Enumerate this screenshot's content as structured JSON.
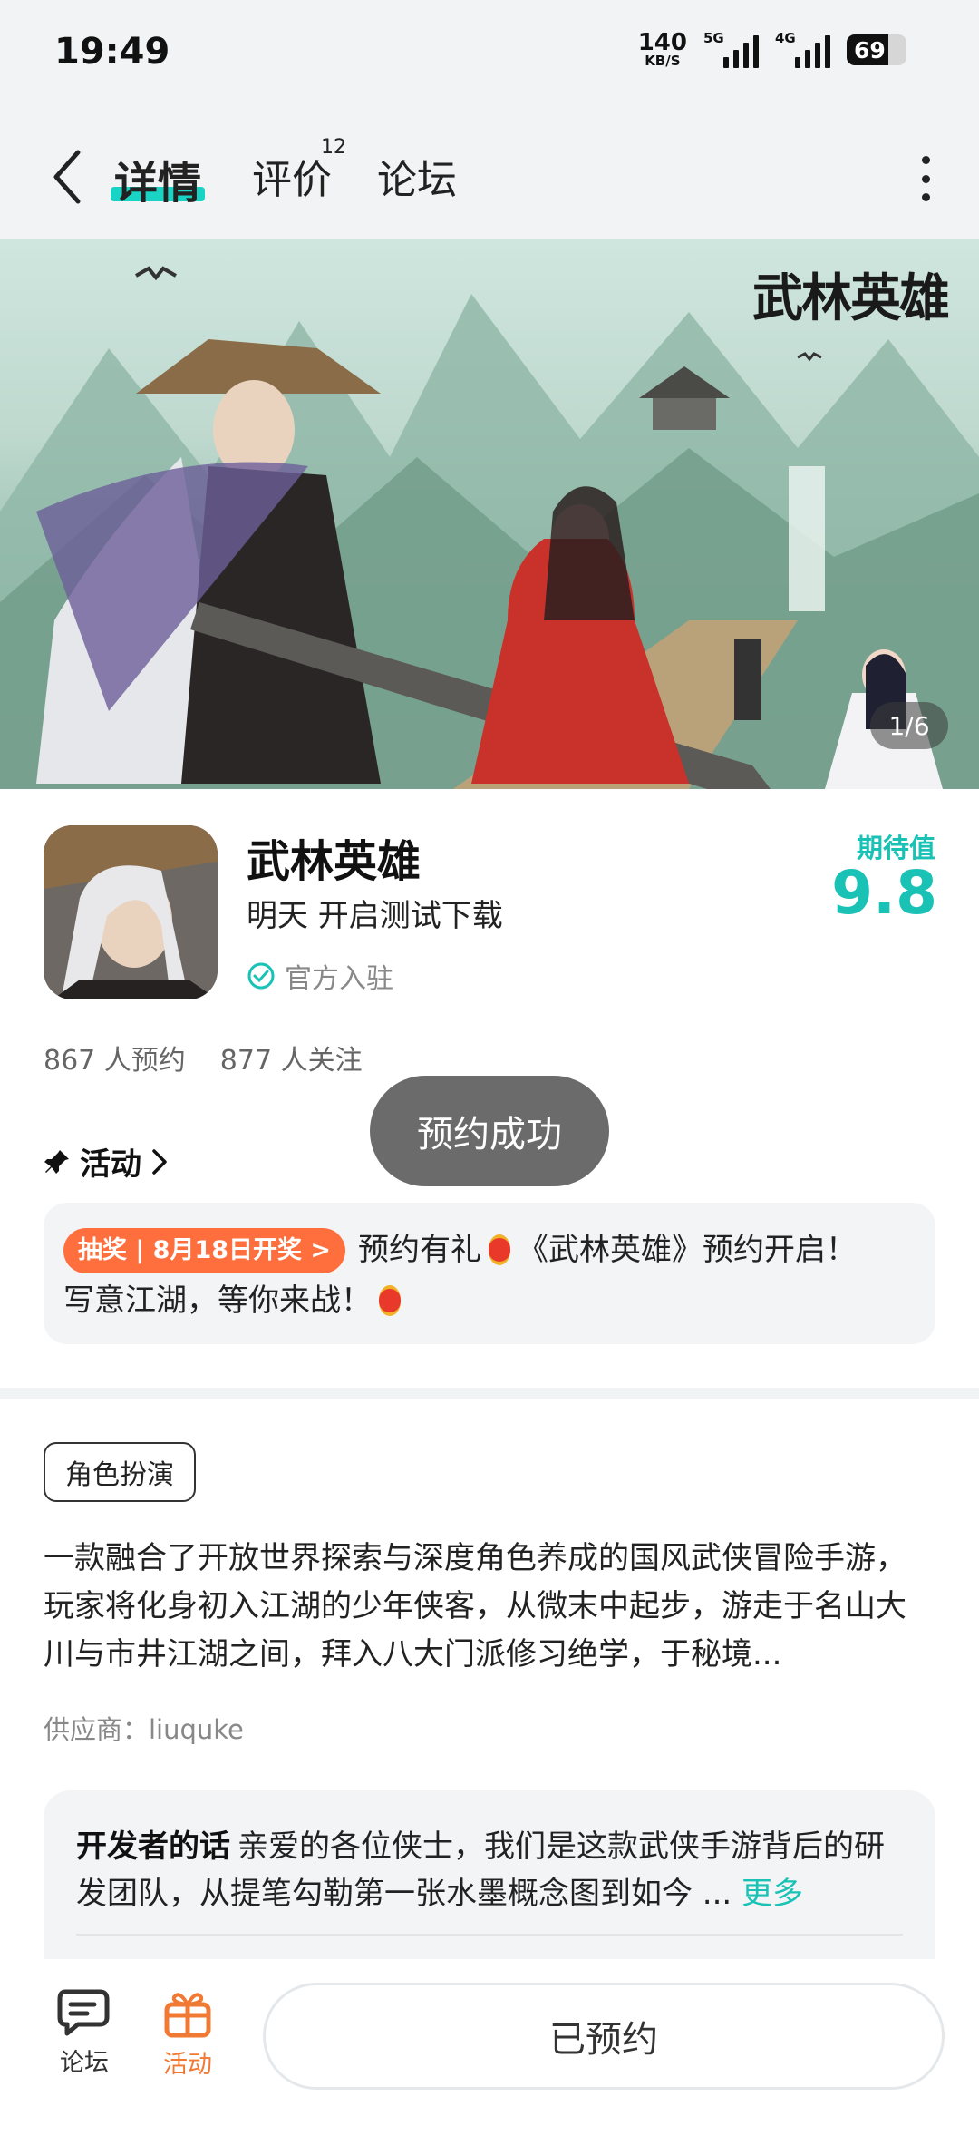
{
  "status_bar": {
    "time": "19:49",
    "net_speed": "140",
    "net_unit": "KB/S",
    "signal_1": "5G",
    "signal_2": "4G",
    "battery": "69"
  },
  "header": {
    "tabs": [
      {
        "label": "详情",
        "active": true
      },
      {
        "label": "评价",
        "badge": "12"
      },
      {
        "label": "论坛"
      }
    ],
    "back_icon": "chevron-left-icon",
    "more_icon": "more-vertical-icon"
  },
  "banner": {
    "logo_text": "武林英雄",
    "counter": "1/6"
  },
  "app": {
    "name": "武林英雄",
    "subtitle": "明天 开启测试下载",
    "official": "官方入驻",
    "score_label": "期待值",
    "score": "9.8",
    "stats": [
      "867 人预约",
      "877 人关注"
    ]
  },
  "toast": "预约成功",
  "activity": {
    "title": "活动",
    "tag": "抽奖 | 8月18日开奖 >",
    "text_1": "预约有礼",
    "text_2": "《武林英雄》预约开启！",
    "text_3": "写意江湖，等你来战！"
  },
  "details": {
    "genre": "角色扮演",
    "description": "一款融合了开放世界探索与深度角色养成的国风武侠冒险手游，玩家将化身初入江湖的少年侠客，从微末中起步，游走于名山大川与市井江湖之间，拜入八大门派修习绝学，于秘境...",
    "supplier": "供应商：liuquke"
  },
  "developer": {
    "title": "开发者的话",
    "text": "亲爱的各位侠士，我们是这款武侠手游背后的研发团队，从提笔勾勒第一张水墨概念图到如今 ...",
    "more": "更多"
  },
  "bottom_bar": {
    "forum_label": "论坛",
    "activity_label": "活动",
    "reserved_label": "已预约",
    "accent": "#f07a34"
  },
  "colors": {
    "teal": "#19c2b5",
    "orange_tag": "#ff6f3d"
  }
}
